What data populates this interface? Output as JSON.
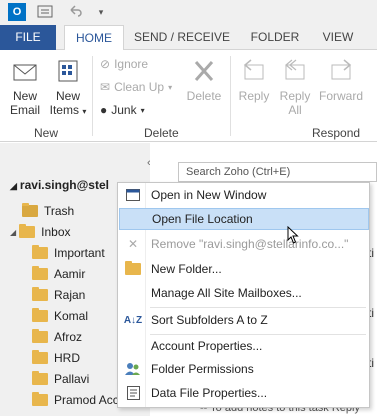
{
  "quick_access": {
    "icons": [
      "outlook-logo-icon",
      "send-receive-icon",
      "undo-icon",
      "customize-icon"
    ]
  },
  "tabs": [
    "FILE",
    "HOME",
    "SEND / RECEIVE",
    "FOLDER",
    "VIEW"
  ],
  "ribbon": {
    "new_email": "New\nEmail",
    "new_email_l1": "New",
    "new_email_l2": "Email",
    "new_items_l1": "New",
    "new_items_l2": "Items",
    "new_group": "New",
    "ignore": "Ignore",
    "clean_up": "Clean Up",
    "junk": "Junk",
    "delete": "Delete",
    "delete_group": "Delete",
    "reply": "Reply",
    "reply_all_l1": "Reply",
    "reply_all_l2": "All",
    "forward": "Forward",
    "respond_group": "Respond"
  },
  "left_pane": {
    "account": "ravi.singh@stel",
    "folders": [
      "Trash",
      "Inbox",
      "Important",
      "Aamir",
      "Rajan",
      "Komal",
      "Afroz",
      "HRD",
      "Pallavi",
      "Pramod Acc"
    ]
  },
  "search": {
    "placeholder": "Search Zoho (Ctrl+E)"
  },
  "context_menu": {
    "items": [
      "Open in New Window",
      "Open File Location",
      "Remove \"ravi.singh@stellarinfo.co...\"",
      "New Folder...",
      "Manage All Site Mailboxes...",
      "Sort Subfolders A to Z",
      "Account Properties...",
      "Folder Permissions",
      "Data File Properties..."
    ]
  },
  "bottom_text": "-- To add notes to this task Reply",
  "colors": {
    "accent": "#2b579a",
    "highlight": "#c9e0f7",
    "folder": "#e8b64c"
  }
}
